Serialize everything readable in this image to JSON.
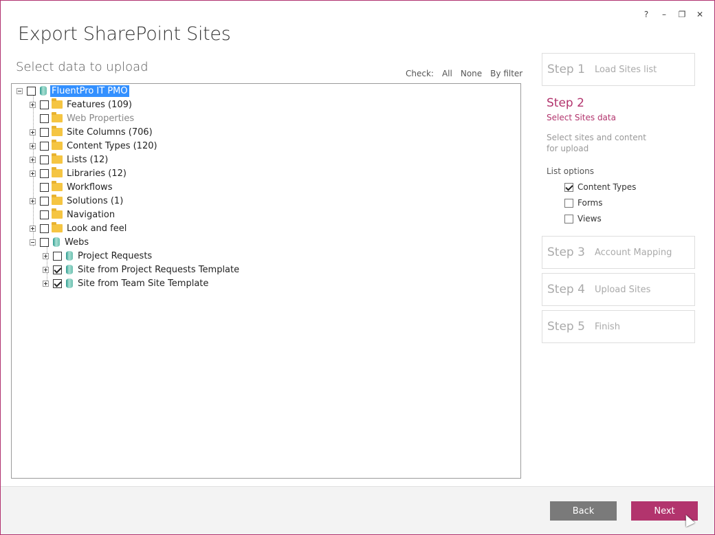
{
  "window": {
    "title": "Export SharePoint Sites",
    "controls": {
      "help": "?",
      "minimize": "–",
      "restore": "❐",
      "close": "✕"
    }
  },
  "section_title": "Select data to upload",
  "check": {
    "label": "Check:",
    "all": "All",
    "none": "None",
    "by_filter": "By filter"
  },
  "tree": {
    "root": "FluentPro IT PMO",
    "items": [
      {
        "label": "Features (109)"
      },
      {
        "label": "Web Properties"
      },
      {
        "label": "Site Columns (706)"
      },
      {
        "label": "Content Types (120)"
      },
      {
        "label": "Lists (12)"
      },
      {
        "label": "Libraries (12)"
      },
      {
        "label": "Workflows"
      },
      {
        "label": "Solutions (1)"
      },
      {
        "label": "Navigation"
      },
      {
        "label": "Look and feel"
      },
      {
        "label": "Webs"
      }
    ],
    "webs": [
      {
        "label": "Project Requests",
        "checked": false
      },
      {
        "label": "Site from Project Requests Template",
        "checked": true
      },
      {
        "label": "Site from Team Site Template",
        "checked": true
      }
    ]
  },
  "steps": {
    "step1": {
      "num": "Step 1",
      "name": "Load Sites list"
    },
    "step2": {
      "num": "Step 2",
      "name": "Select Sites data",
      "description": "Select sites and content for upload",
      "list_options_label": "List options",
      "options": [
        {
          "label": "Content Types",
          "checked": true
        },
        {
          "label": "Forms",
          "checked": false
        },
        {
          "label": "Views",
          "checked": false
        }
      ]
    },
    "step3": {
      "num": "Step 3",
      "name": "Account Mapping"
    },
    "step4": {
      "num": "Step 4",
      "name": "Upload Sites"
    },
    "step5": {
      "num": "Step 5",
      "name": "Finish"
    }
  },
  "footer": {
    "back_label": "Back",
    "next_label": "Next"
  },
  "colors": {
    "accent": "#b2346d",
    "selection": "#3390ff",
    "back_button": "#7a7a7a"
  }
}
